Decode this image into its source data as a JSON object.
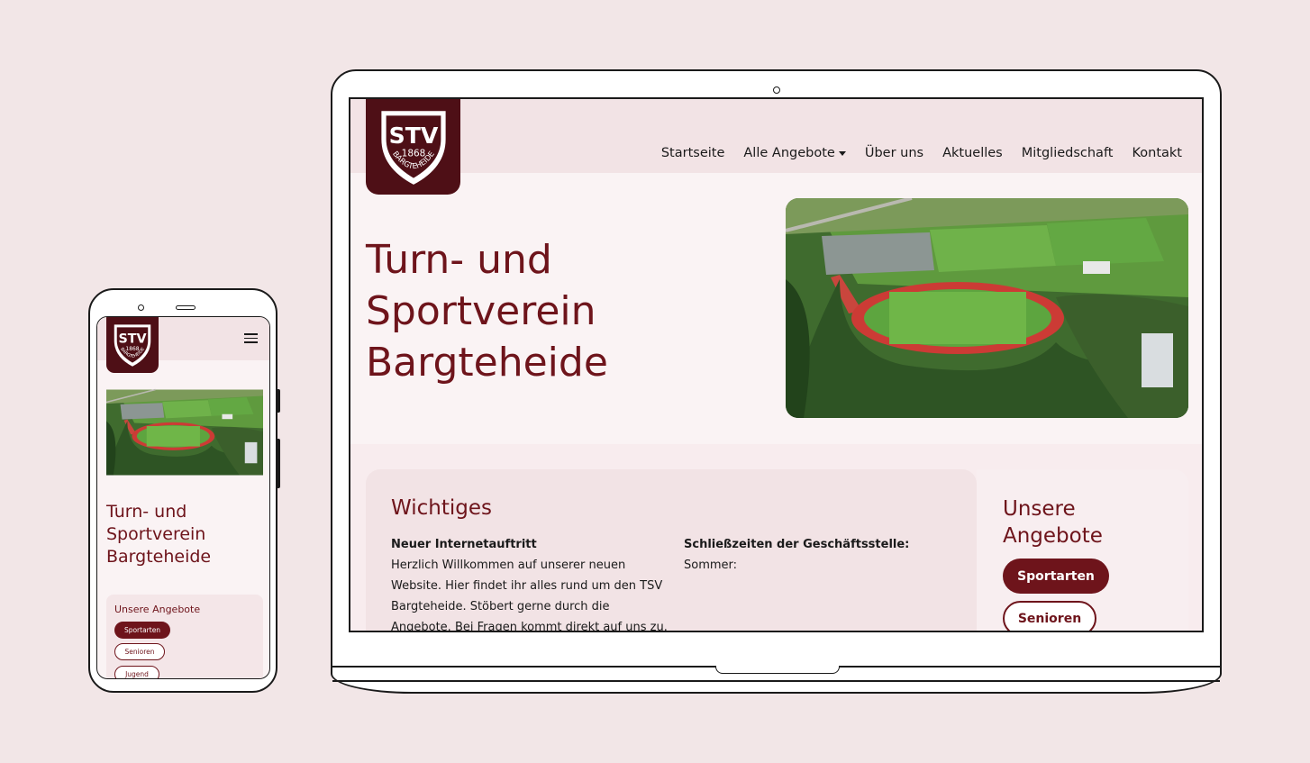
{
  "brand": {
    "logo_text": "STV",
    "logo_year": "1868",
    "logo_arc": "BARGTEHEIDE",
    "primary_color": "#6e141b",
    "dark_color": "#4e0f16",
    "background_color": "#f2e6e7"
  },
  "nav": {
    "items": [
      "Startseite",
      "Alle Angebote",
      "Über uns",
      "Aktuelles",
      "Mitgliedschaft",
      "Kontakt"
    ],
    "dropdown_icon": "caret-down-icon"
  },
  "hero": {
    "title_lines": [
      "Turn- und",
      "Sportverein",
      "Bargteheide"
    ]
  },
  "wichtiges": {
    "title": "Wichtiges",
    "col1_heading": "Neuer Internetauftritt",
    "col1_lines": [
      "Herzlich Willkommen auf unserer neuen",
      "Website. Hier findet ihr alles rund um den TSV",
      "Bargteheide. Stöbert gerne durch die",
      "Angebote. Bei Fragen kommt direkt auf uns zu."
    ],
    "col2_heading": "Schließzeiten der Geschäftsstelle:",
    "col2_text": "Sommer:"
  },
  "angebote": {
    "title_lines": [
      "Unsere",
      "Angebote"
    ],
    "buttons": [
      "Sportarten",
      "Senioren"
    ]
  },
  "mobile": {
    "menu_icon": "hamburger-menu-icon",
    "angebote_title": "Unsere Angebote",
    "buttons": [
      "Sportarten",
      "Senioren",
      "Jugend"
    ]
  }
}
